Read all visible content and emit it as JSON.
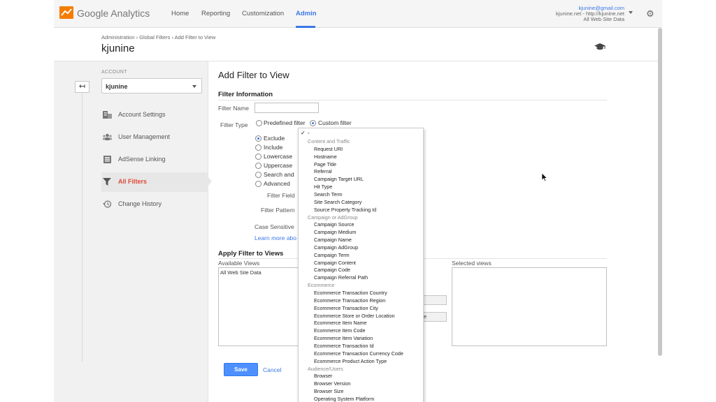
{
  "header": {
    "brand": "Google Analytics",
    "nav": [
      "Home",
      "Reporting",
      "Customization",
      "Admin"
    ],
    "active_nav": "Admin",
    "account_email": "kjunine@gmail.com",
    "account_property": "kjunine.net - http://kjunine.net",
    "account_view": "All Web Site Data"
  },
  "page": {
    "breadcrumb": "Administration › Global Filters › Add Filter to View",
    "title": "kjunine"
  },
  "sidebar": {
    "account_label": "ACCOUNT",
    "account_value": "kjunine",
    "items": [
      {
        "label": "Account Settings",
        "icon": "building-icon"
      },
      {
        "label": "User Management",
        "icon": "users-icon"
      },
      {
        "label": "AdSense Linking",
        "icon": "adsense-icon"
      },
      {
        "label": "All Filters",
        "icon": "filter-icon",
        "active": true
      },
      {
        "label": "Change History",
        "icon": "history-icon"
      }
    ]
  },
  "main": {
    "title": "Add Filter to View",
    "filter_info_heading": "Filter Information",
    "filter_name_label": "Filter Name",
    "filter_name_value": "",
    "filter_type_label": "Filter Type",
    "filter_type_options": [
      "Predefined filter",
      "Custom filter"
    ],
    "filter_type_selected": "Custom filter",
    "custom_options": [
      "Exclude",
      "Include",
      "Lowercase",
      "Uppercase",
      "Search and",
      "Advanced"
    ],
    "custom_selected": "Exclude",
    "filter_field_label": "Filter Field",
    "filter_pattern_label": "Filter Pattern",
    "case_sensitive_label": "Case Sensitive",
    "learn_more": "Learn more abo",
    "apply_heading": "Apply Filter to Views",
    "available_views_label": "Available Views",
    "available_views": [
      "All Web Site Data"
    ],
    "selected_views_label": "Selected views",
    "add_button_fragment": "",
    "remove_button_fragment": "e",
    "save": "Save",
    "cancel": "Cancel"
  },
  "dropdown": {
    "selected": "-",
    "groups": [
      {
        "label": "Content and Traffic",
        "items": [
          "Request URI",
          "Hostname",
          "Page Title",
          "Referral",
          "Campaign Target URL",
          "Hit Type",
          "Search Term",
          "Site Search Category",
          "Source Property Tracking Id"
        ]
      },
      {
        "label": "Campaign or AdGroup",
        "items": [
          "Campaign Source",
          "Campaign Medium",
          "Campaign Name",
          "Campaign AdGroup",
          "Campaign Term",
          "Campaign Content",
          "Campaign Code",
          "Campaign Referral Path"
        ]
      },
      {
        "label": "Ecommerce",
        "items": [
          "Ecommerce Transaction Country",
          "Ecommerce Transaction Region",
          "Ecommerce Transaction City",
          "Ecommerce Store or Order Location",
          "Ecommerce Item Name",
          "Ecommerce Item Code",
          "Ecommerce Item Variation",
          "Ecommerce Transaction Id",
          "Ecommerce Transaction Currency Code",
          "Ecommerce Product Action Type"
        ]
      },
      {
        "label": "Audience/Users",
        "items": [
          "Browser",
          "Browser Version",
          "Browser Size",
          "Operating System Platform"
        ]
      }
    ]
  },
  "colors": {
    "accent": "#3b78e7",
    "active_menu": "#dd4b39",
    "save_button": "#4d90fe",
    "logo_orange": "#f57c00"
  }
}
